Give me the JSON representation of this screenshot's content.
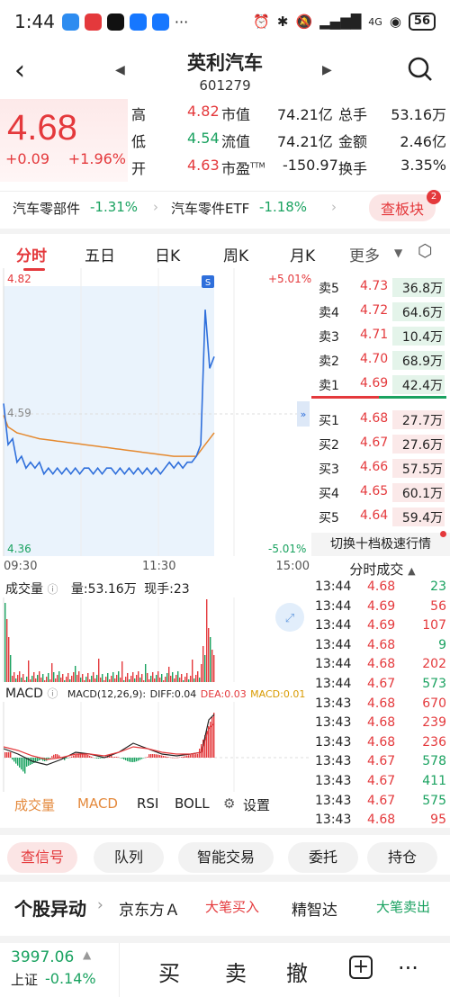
{
  "status_bar": {
    "time": "1:44",
    "network": "4G",
    "battery": "56"
  },
  "header": {
    "stock_name": "英利汽车",
    "stock_code": "601279"
  },
  "quote": {
    "price": "4.68",
    "change": "+0.09",
    "change_pct": "+1.96%",
    "rows": [
      {
        "l1": "高",
        "v1": "4.82",
        "l2": "市值",
        "v2": "74.21亿",
        "l3": "总手",
        "v3": "53.16万"
      },
      {
        "l1": "低",
        "v1": "4.54",
        "l2": "流值",
        "v2": "74.21亿",
        "l3": "金额",
        "v3": "2.46亿"
      },
      {
        "l1": "开",
        "v1": "4.63",
        "l2": "市盈",
        "l2sup": "TTM",
        "v2": "-150.97",
        "l3": "换手",
        "v3": "3.35%"
      }
    ]
  },
  "sector": {
    "name1": "汽车零部件",
    "chg1": "-1.31%",
    "name2": "汽车零件ETF",
    "chg2": "-1.18%",
    "button": "查板块",
    "badge": "2"
  },
  "tabs": [
    "分时",
    "五日",
    "日K",
    "周K",
    "月K",
    "更多"
  ],
  "chart_data": [
    {
      "type": "line",
      "title": "",
      "y_top": "4.82",
      "y_top_pct": "+5.01%",
      "y_bottom": "4.36",
      "y_bottom_pct": "-5.01%",
      "mid_label": "4.59",
      "x_ticks": [
        "09:30",
        "11:30",
        "15:00"
      ],
      "ylim": [
        4.36,
        4.82
      ],
      "series": [
        {
          "values": [
            4.62,
            4.55,
            4.56,
            4.52,
            4.53,
            4.51,
            4.52,
            4.51,
            4.52,
            4.5,
            4.51,
            4.5,
            4.51,
            4.5,
            4.51,
            4.5,
            4.51,
            4.5,
            4.51,
            4.51,
            4.5,
            4.51,
            4.5,
            4.51,
            4.51,
            4.5,
            4.51,
            4.5,
            4.51,
            4.5,
            4.51,
            4.5,
            4.51,
            4.5,
            4.51,
            4.5,
            4.51,
            4.52,
            4.51,
            4.52,
            4.51,
            4.52,
            4.52,
            4.53,
            4.55,
            4.78,
            4.68,
            4.7
          ],
          "color": "#2f6fdb"
        },
        {
          "values": [
            4.6,
            4.58,
            4.575,
            4.57,
            4.568,
            4.566,
            4.564,
            4.562,
            4.56,
            4.559,
            4.558,
            4.557,
            4.556,
            4.555,
            4.554,
            4.553,
            4.552,
            4.551,
            4.55,
            4.549,
            4.548,
            4.547,
            4.546,
            4.545,
            4.544,
            4.543,
            4.542,
            4.541,
            4.54,
            4.539,
            4.538,
            4.537,
            4.536,
            4.535,
            4.534,
            4.533,
            4.532,
            4.531,
            4.53,
            4.53,
            4.53,
            4.53,
            4.53,
            4.53,
            4.54,
            4.55,
            4.56,
            4.57
          ],
          "color": "#e5892f"
        }
      ],
      "marker": "S"
    },
    {
      "type": "bar",
      "title": "成交量",
      "volume_label": "量:53.16万",
      "current_label": "现手:23"
    },
    {
      "type": "bar",
      "title": "MACD",
      "params": "MACD(12,26,9):",
      "diff": "DIFF:0.04",
      "dea": "DEA:0.03",
      "macd": "MACD:0.01"
    }
  ],
  "orderbook": {
    "sell": [
      {
        "label": "卖5",
        "price": "4.73",
        "vol": "36.8万"
      },
      {
        "label": "卖4",
        "price": "4.72",
        "vol": "64.6万"
      },
      {
        "label": "卖3",
        "price": "4.71",
        "vol": "10.4万"
      },
      {
        "label": "卖2",
        "price": "4.70",
        "vol": "68.9万"
      },
      {
        "label": "卖1",
        "price": "4.69",
        "vol": "42.4万"
      }
    ],
    "buy": [
      {
        "label": "买1",
        "price": "4.68",
        "vol": "27.7万"
      },
      {
        "label": "买2",
        "price": "4.67",
        "vol": "27.6万"
      },
      {
        "label": "买3",
        "price": "4.66",
        "vol": "57.5万"
      },
      {
        "label": "买4",
        "price": "4.65",
        "vol": "60.1万"
      },
      {
        "label": "买5",
        "price": "4.64",
        "vol": "59.4万"
      }
    ],
    "switch_label": "切换十档极速行情"
  },
  "ticks": {
    "title": "分时成交",
    "rows": [
      {
        "t": "13:44",
        "p": "4.68",
        "v": "23",
        "c": "green"
      },
      {
        "t": "13:44",
        "p": "4.69",
        "v": "56",
        "c": "red"
      },
      {
        "t": "13:44",
        "p": "4.69",
        "v": "107",
        "c": "red"
      },
      {
        "t": "13:44",
        "p": "4.68",
        "v": "9",
        "c": "green"
      },
      {
        "t": "13:44",
        "p": "4.68",
        "v": "202",
        "c": "red"
      },
      {
        "t": "13:44",
        "p": "4.67",
        "v": "573",
        "c": "green"
      },
      {
        "t": "13:43",
        "p": "4.68",
        "v": "670",
        "c": "red"
      },
      {
        "t": "13:43",
        "p": "4.68",
        "v": "239",
        "c": "red"
      },
      {
        "t": "13:43",
        "p": "4.68",
        "v": "236",
        "c": "red"
      },
      {
        "t": "13:43",
        "p": "4.67",
        "v": "578",
        "c": "green"
      },
      {
        "t": "13:43",
        "p": "4.67",
        "v": "411",
        "c": "green"
      },
      {
        "t": "13:43",
        "p": "4.67",
        "v": "575",
        "c": "green"
      },
      {
        "t": "13:43",
        "p": "4.68",
        "v": "95",
        "c": "red"
      }
    ]
  },
  "indicator_tabs": {
    "vol": "成交量",
    "macd": "MACD",
    "rsi": "RSI",
    "boll": "BOLL",
    "settings": "设置"
  },
  "actions": [
    "查信号",
    "队列",
    "智能交易",
    "委托",
    "持仓"
  ],
  "unusual": {
    "title": "个股异动",
    "s1": "京东方Ａ",
    "a1": "大笔买入",
    "s2": "精智达",
    "a2": "大笔卖出"
  },
  "bottom": {
    "index_value": "3997.06",
    "index_name": "上证",
    "index_chg": "-0.14%",
    "buy": "买",
    "sell": "卖",
    "cancel": "撤"
  }
}
